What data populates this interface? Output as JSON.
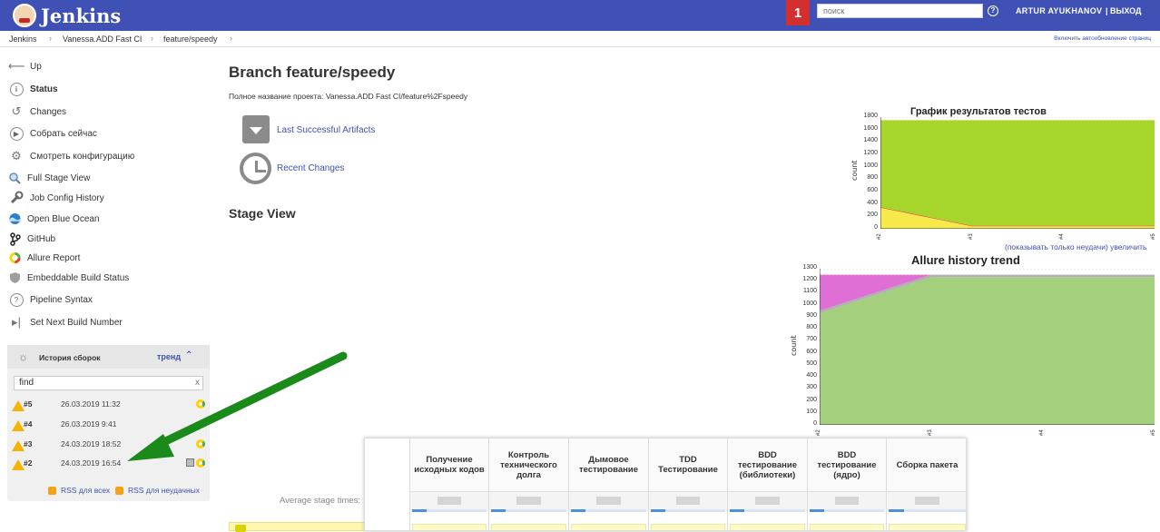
{
  "header": {
    "logo_text": "Jenkins",
    "notification_count": "1",
    "search_placeholder": "поиск",
    "user": "ARTUR AYUKHANOV",
    "logout": "| ВЫХОД"
  },
  "breadcrumbs": [
    "Jenkins",
    "Vanessa.ADD Fast CI",
    "feature/speedy"
  ],
  "autorefresh": "Включить автообновление страниц",
  "sidebar": {
    "items": [
      {
        "label": "Up",
        "icon": "arrow-left-icon"
      },
      {
        "label": "Status",
        "icon": "info-icon"
      },
      {
        "label": "Changes",
        "icon": "history-icon"
      },
      {
        "label": "Собрать сейчас",
        "icon": "play-icon"
      },
      {
        "label": "Смотреть конфигурацию",
        "icon": "gear-icon"
      },
      {
        "label": "Full Stage View",
        "icon": "magnifier-icon"
      },
      {
        "label": "Job Config History",
        "icon": "wrench-icon"
      },
      {
        "label": "Open Blue Ocean",
        "icon": "blue-ocean-icon"
      },
      {
        "label": "GitHub",
        "icon": "git-branch-icon"
      },
      {
        "label": "Allure Report",
        "icon": "allure-icon"
      },
      {
        "label": "Embeddable Build Status",
        "icon": "shield-icon"
      },
      {
        "label": "Pipeline Syntax",
        "icon": "question-icon"
      },
      {
        "label": "Set Next Build Number",
        "icon": "next-icon"
      }
    ]
  },
  "build_history": {
    "title": "История сборок",
    "trend": "тренд",
    "filter_value": "find",
    "filter_clear": "x",
    "builds": [
      {
        "number": "#5",
        "date": "26.03.2019 11:32"
      },
      {
        "number": "#4",
        "date": "26.03.2019 9:41"
      },
      {
        "number": "#3",
        "date": "24.03.2019 18:52"
      },
      {
        "number": "#2",
        "date": "24.03.2019 16:54"
      }
    ],
    "rss_all": "RSS для всех",
    "rss_failed": "RSS для неудачных"
  },
  "main": {
    "title": "Branch feature/speedy",
    "full_name": "Полное название проекта: Vanessa.ADD Fast CI/feature%2Fspeedy",
    "last_successful_artifacts": "Last Successful Artifacts",
    "recent_changes": "Recent Changes",
    "stage_view": "Stage View",
    "average_stage_times": "Average stage times:",
    "stages": [
      "Получение исходных кодов",
      "Контроль технического долга",
      "Дымовое тестирование",
      "TDD Тестирование",
      "BDD тестирование (библиотеки)",
      "BDD тестирование (ядро)",
      "Сборка пакета"
    ],
    "chart_links": "(показывать только неудачи) увеличить"
  },
  "colors": {
    "header": "#3f51b5",
    "notif": "#d32f2f",
    "link": "#3f51b5",
    "warning": "#f6b400",
    "arrow": "#1a8a1a",
    "passed_green": "#a6d62b",
    "allure_green": "#a4cf7d",
    "allure_pink": "#e06fd5",
    "skipped_yellow": "#f7e94a"
  },
  "chart_data": [
    {
      "type": "area",
      "title": "График результатов тестов",
      "ylabel": "count",
      "categories": [
        "#2",
        "#3",
        "#4",
        "#5"
      ],
      "ylim": [
        0,
        1800
      ],
      "yticks": [
        0,
        200,
        400,
        600,
        800,
        1000,
        1200,
        1400,
        1600,
        1800
      ],
      "series": [
        {
          "values": [
            340,
            40,
            40,
            40
          ],
          "color": "#f7e94a"
        },
        {
          "values": [
            10,
            10,
            10,
            10
          ],
          "color": "#e53935"
        },
        {
          "values": [
            1400,
            1700,
            1700,
            1700
          ],
          "color": "#a6d62b"
        }
      ]
    },
    {
      "type": "area",
      "title": "Allure history trend",
      "ylabel": "count",
      "categories": [
        "#2",
        "#3",
        "#4",
        "#5"
      ],
      "ylim": [
        0,
        1300
      ],
      "yticks": [
        0,
        100,
        200,
        300,
        400,
        500,
        600,
        700,
        800,
        900,
        1000,
        1100,
        1200,
        1300
      ],
      "series": [
        {
          "values": [
            930,
            1230,
            1230,
            1230
          ],
          "color": "#a4cf7d"
        },
        {
          "values": [
            20,
            20,
            20,
            20
          ],
          "color": "#b0b0b0"
        },
        {
          "values": [
            300,
            0,
            0,
            0
          ],
          "color": "#e06fd5"
        }
      ]
    }
  ]
}
